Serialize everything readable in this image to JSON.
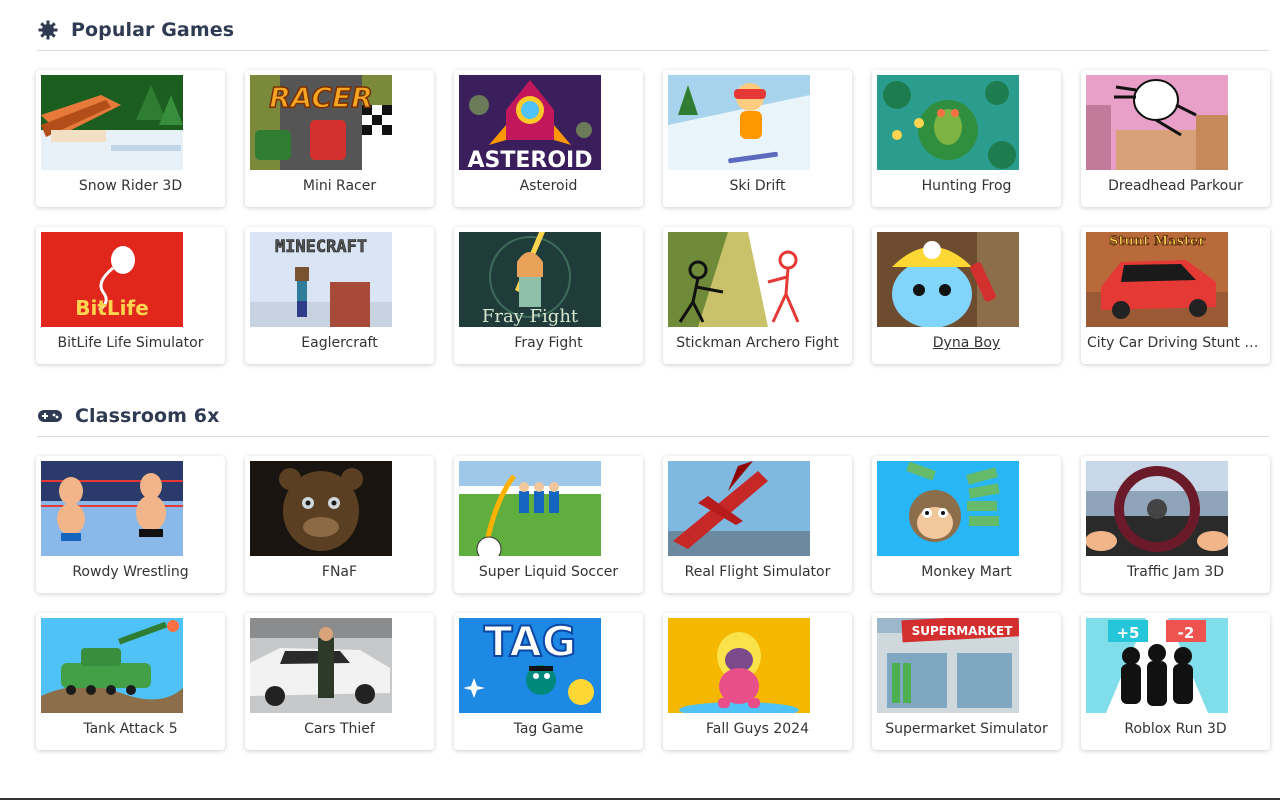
{
  "sections": [
    {
      "title": "Popular Games",
      "icon": "gear-icon",
      "games": [
        {
          "name": "Snow Rider 3D"
        },
        {
          "name": "Mini Racer",
          "thumb_text": "RACER"
        },
        {
          "name": "Asteroid",
          "thumb_text": "ASTEROID"
        },
        {
          "name": "Ski Drift"
        },
        {
          "name": "Hunting Frog"
        },
        {
          "name": "Dreadhead Parkour"
        },
        {
          "name": "BitLife Life Simulator",
          "thumb_text": "BitLife"
        },
        {
          "name": "Eaglercraft",
          "thumb_text": "MINECRAFT"
        },
        {
          "name": "Fray Fight",
          "thumb_text": "Fray Fight"
        },
        {
          "name": "Stickman Archero Fight"
        },
        {
          "name": "Dyna Boy",
          "underlined": true
        },
        {
          "name": "City Car Driving Stunt Master",
          "thumb_text": "Stunt Master"
        }
      ]
    },
    {
      "title": "Classroom 6x",
      "icon": "gamepad-icon",
      "games": [
        {
          "name": "Rowdy Wrestling"
        },
        {
          "name": "FNaF"
        },
        {
          "name": "Super Liquid Soccer"
        },
        {
          "name": "Real Flight Simulator"
        },
        {
          "name": "Monkey Mart"
        },
        {
          "name": "Traffic Jam 3D"
        },
        {
          "name": "Tank Attack 5"
        },
        {
          "name": "Cars Thief"
        },
        {
          "name": "Tag Game",
          "thumb_text": "TAG"
        },
        {
          "name": "Fall Guys 2024"
        },
        {
          "name": "Supermarket Simulator",
          "thumb_text": "SUPERMARKET"
        },
        {
          "name": "Roblox Run 3D",
          "thumb_text": [
            "+5",
            "-2"
          ]
        }
      ]
    }
  ],
  "colors": {
    "heading": "#2f3b52",
    "divider": "#dcdcdc",
    "card_text": "#333333"
  }
}
